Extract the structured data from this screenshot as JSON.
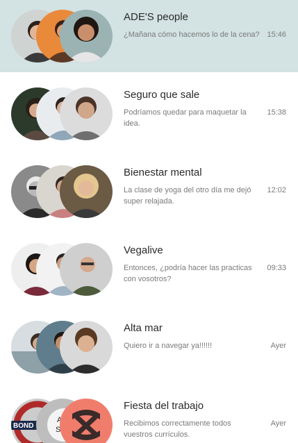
{
  "conversations": [
    {
      "title": "ADE'S people",
      "message": "¿Mañana cómo hacemos lo de la cena?",
      "time": "15:46",
      "selected": true
    },
    {
      "title": "Seguro que sale",
      "message": "Podríamos quedar para maquetar la idea.",
      "time": "15:38"
    },
    {
      "title": "Bienestar mental",
      "message": "La clase de yoga del otro día me dejó super relajada.",
      "time": "12:02"
    },
    {
      "title": "Vegalive",
      "message": "Entonces, ¿podría hacer las practicas con vosotros?",
      "time": "09:33"
    },
    {
      "title": "Alta mar",
      "message": "Quiero ir a navegar ya!!!!!!",
      "time": "Ayer"
    },
    {
      "title": "Fiesta del trabajo",
      "message": "Recibimos correctamente todos vuestros currículos.",
      "time": "Ayer",
      "avatar_text": [
        "BOND",
        "ART",
        "SIGN"
      ]
    }
  ],
  "colors": {
    "selected_bg": "#d3e2e2",
    "muted_text": "#7a7a7a",
    "title_text": "#2a2a2a"
  }
}
